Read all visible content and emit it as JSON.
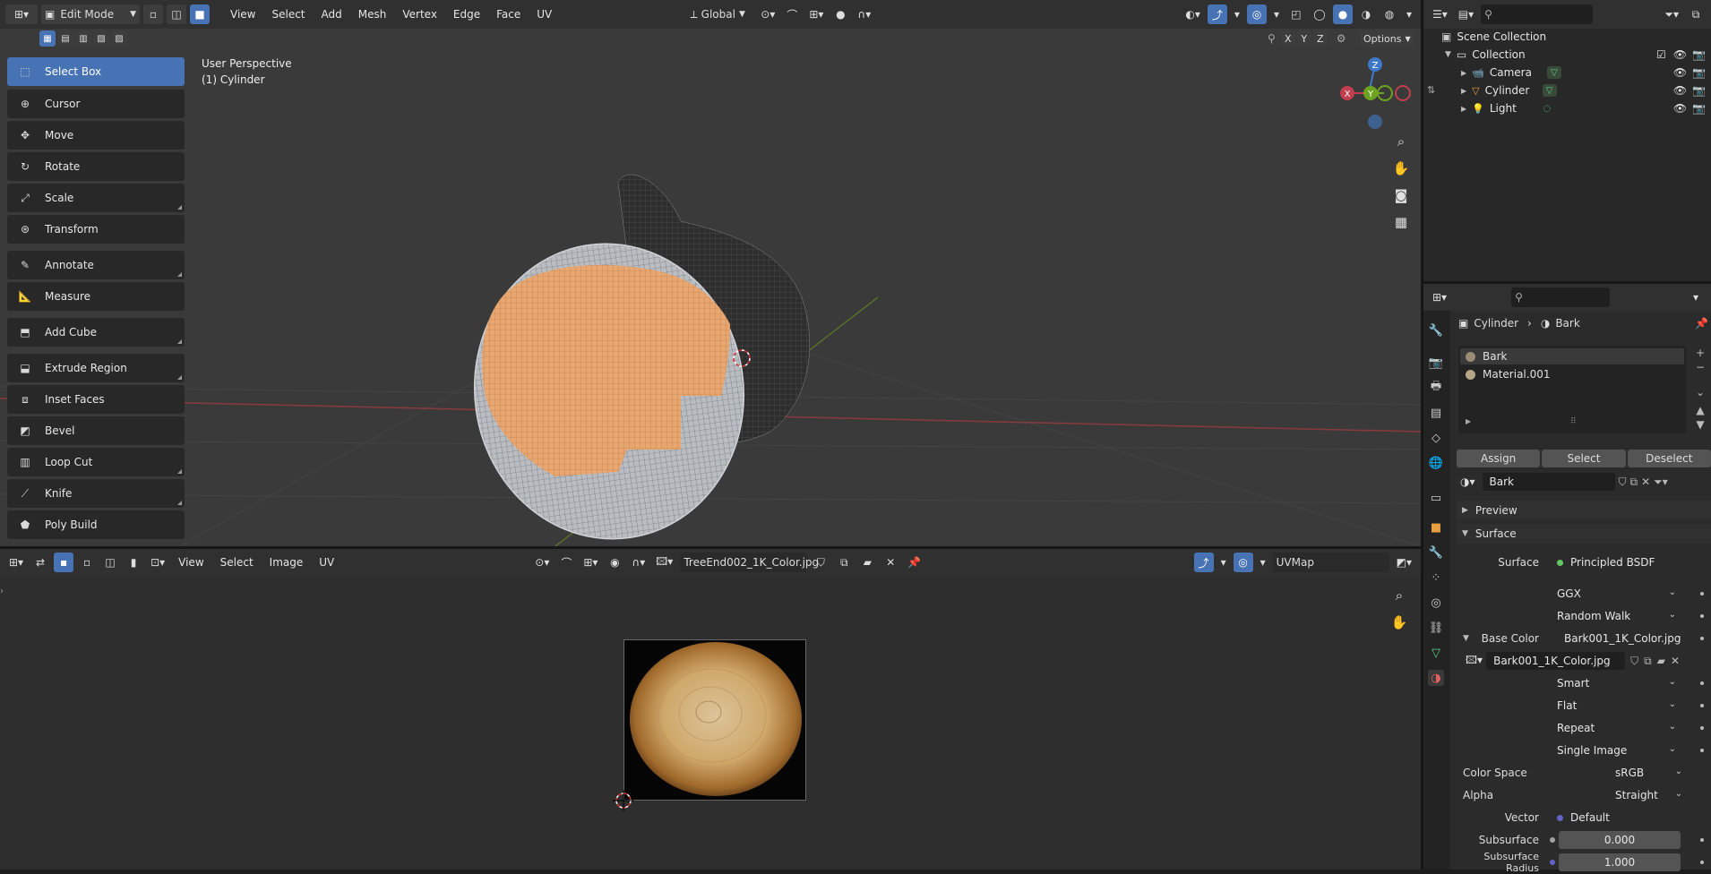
{
  "topbar": {
    "mode": "Edit Mode",
    "menus": [
      "View",
      "Select",
      "Add",
      "Mesh",
      "Vertex",
      "Edge",
      "Face",
      "UV"
    ],
    "transform_orientation": "Global",
    "axis_x": "X",
    "axis_y": "Y",
    "axis_z": "Z",
    "options": "Options"
  },
  "viewport": {
    "perspective": "User Perspective",
    "object": "(1) Cylinder",
    "gizmo_z": "Z",
    "gizmo_y": "Y",
    "gizmo_x": "X"
  },
  "toolbar": {
    "items": [
      {
        "label": "Select Box",
        "icon": "select-box-icon"
      },
      {
        "label": "Cursor",
        "icon": "cursor-icon"
      },
      {
        "label": "Move",
        "icon": "move-icon"
      },
      {
        "label": "Rotate",
        "icon": "rotate-icon"
      },
      {
        "label": "Scale",
        "icon": "scale-icon"
      },
      {
        "label": "Transform",
        "icon": "transform-icon"
      },
      {
        "label": "Annotate",
        "icon": "annotate-icon"
      },
      {
        "label": "Measure",
        "icon": "measure-icon"
      },
      {
        "label": "Add Cube",
        "icon": "add-cube-icon"
      },
      {
        "label": "Extrude Region",
        "icon": "extrude-icon"
      },
      {
        "label": "Inset Faces",
        "icon": "inset-icon"
      },
      {
        "label": "Bevel",
        "icon": "bevel-icon"
      },
      {
        "label": "Loop Cut",
        "icon": "loop-cut-icon"
      },
      {
        "label": "Knife",
        "icon": "knife-icon"
      },
      {
        "label": "Poly Build",
        "icon": "poly-build-icon"
      }
    ]
  },
  "uv_editor": {
    "menus": [
      "View",
      "Select",
      "Image",
      "UV"
    ],
    "image_name": "TreeEnd002_1K_Color.jpg",
    "uv_map": "UVMap"
  },
  "outliner": {
    "root": "Scene Collection",
    "collection": "Collection",
    "items": [
      {
        "label": "Camera",
        "icon": "camera-icon"
      },
      {
        "label": "Cylinder",
        "icon": "mesh-icon"
      },
      {
        "label": "Light",
        "icon": "light-icon"
      }
    ]
  },
  "properties": {
    "breadcrumb_object": "Cylinder",
    "breadcrumb_material": "Bark",
    "slots": [
      "Bark",
      "Material.001"
    ],
    "assign": "Assign",
    "select": "Select",
    "deselect": "Deselect",
    "material_name": "Bark",
    "preview": "Preview",
    "surface_panel": "Surface",
    "surface_label": "Surface",
    "surface_value": "Principled BSDF",
    "distribution": "GGX",
    "subsurface_method": "Random Walk",
    "base_color_label": "Base Color",
    "base_color_value": "Bark001_1K_Color.jpg",
    "image_block": "Bark001_1K_Color.jpg",
    "interpolation": "Smart",
    "projection": "Flat",
    "extension": "Repeat",
    "source": "Single Image",
    "color_space_label": "Color Space",
    "color_space": "sRGB",
    "alpha_label": "Alpha",
    "alpha": "Straight",
    "vector_label": "Vector",
    "vector_value": "Default",
    "subsurface_label": "Subsurface",
    "subsurface_value": "0.000",
    "subsurface_radius_label": "Subsurface Radius",
    "subsurface_radius_value": "1.000"
  },
  "colors": {
    "accent": "#4772b3",
    "selection_face": "#e7a36b",
    "header": "#303030",
    "panel": "#2b2b2b",
    "x_axis": "#c23d4e",
    "y_axis": "#6ea31f",
    "z_axis": "#3e79c9"
  }
}
